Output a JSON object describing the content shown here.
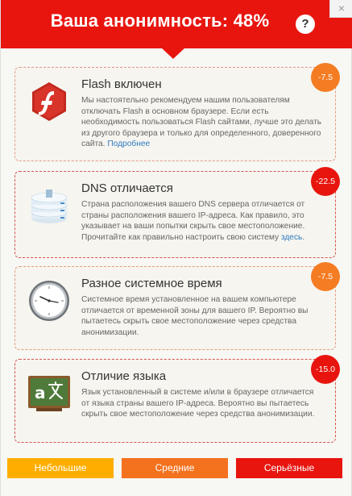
{
  "header": {
    "title": "Ваша анонимность: 48%",
    "help_label": "?",
    "close_label": "×"
  },
  "cards": [
    {
      "title": "Flash включен",
      "text": "Мы настоятельно рекомендуем нашим пользователям отключать Flash в основном браузере. Если есть необходимость пользоваться Flash сайтами, лучше это делать из другого браузера и только для определенного, доверенного сайта.",
      "link": "Подробнее",
      "badge": "-7.5",
      "icon": "flash-icon"
    },
    {
      "title": "DNS отличается",
      "text": "Страна расположения вашего DNS сервера отличается от страны расположения вашего IP-адреса. Как правило, это указывает на ваши попытки скрыть свое местоположение. Прочитайте как правильно настроить свою систему",
      "link": "здесь",
      "link_suffix": ".",
      "badge": "-22.5",
      "icon": "server-icon"
    },
    {
      "title": "Разное системное время",
      "text": "Системное время установленное на вашем компьютере отличается от временной зоны для вашего IP. Вероятно вы пытаетесь скрыть свое местоположение через средства анонимизации.",
      "badge": "-7.5",
      "icon": "clock-icon"
    },
    {
      "title": "Отличие языка",
      "text": "Язык установленный в системе и/или в браузере отличается от языка страны вашего IP-адреса. Вероятно вы пытаетесь скрыть свое местоположение через средства анонимизации.",
      "badge": "-15.0",
      "icon": "translate-icon"
    }
  ],
  "filters": {
    "minor": "Небольшие",
    "medium": "Средние",
    "serious": "Серьёзные"
  },
  "colors": {
    "header_red": "#e8150f",
    "badge_orange": "#f47c23",
    "badge_red": "#e8150f",
    "minor_button": "#ffae00",
    "medium_button": "#f4711e",
    "serious_button": "#e8150f",
    "link_blue": "#2f7cc1"
  }
}
